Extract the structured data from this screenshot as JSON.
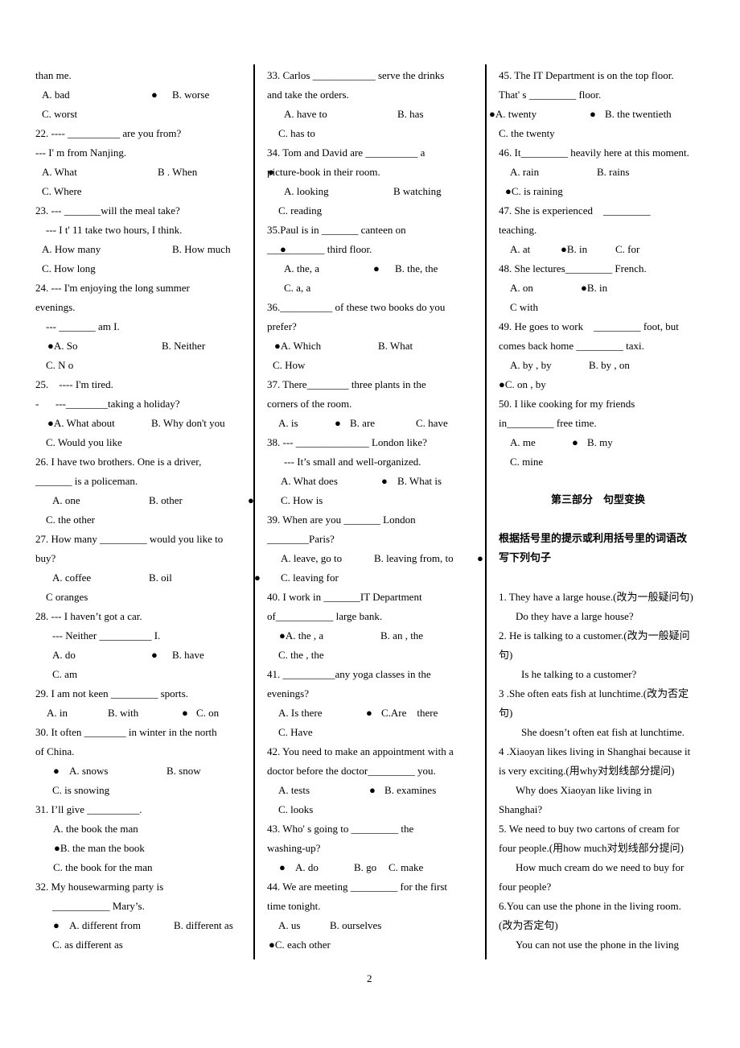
{
  "page_number": "2",
  "columns": {
    "left": [
      [
        "than me."
      ],
      [
        "A. bad",
        "●",
        "B. worse"
      ],
      [
        "C. worst"
      ],
      [
        "22. ---- __________ are you from?"
      ],
      [
        "--- I' m from Nanjing."
      ],
      [
        "A. What",
        "B . When"
      ],
      [
        "C. Where"
      ],
      [
        "23. --- _______will the meal take?"
      ],
      [
        "--- I t' 11 take two hours, I think."
      ],
      [
        "A. How many",
        "B. How much"
      ],
      [
        "C. How long"
      ],
      [
        "24. --- I'm enjoying the long summer"
      ],
      [
        "evenings."
      ],
      [
        "--- _______ am I."
      ],
      [
        "●A. So",
        "B. Neither"
      ],
      [
        "C. N o"
      ],
      [
        "25.    ---- I'm tired."
      ],
      [
        "-",
        "---________taking a holiday?"
      ],
      [
        "●A. What about",
        "B. Why don't you"
      ],
      [
        "C. Would you like"
      ],
      [
        "26. I have two brothers. One is a driver,"
      ],
      [
        "_______ is a policeman."
      ],
      [
        "A. one",
        "B. other",
        "●"
      ],
      [
        "C. the other"
      ],
      [
        "27. How many _________ would you like to"
      ],
      [
        "buy?"
      ],
      [
        "A. coffee",
        "B. oil"
      ],
      [
        "C oranges"
      ],
      [
        "28. --- I haven’t got a car."
      ],
      [
        "--- Neither __________ I."
      ],
      [
        "A. do",
        "●",
        "B. have"
      ],
      [
        "C. am"
      ],
      [
        "29. I am not keen _________ sports."
      ],
      [
        "A. in",
        "B. with",
        "●",
        "C. on"
      ],
      [
        "30. It often ________ in winter in the north"
      ],
      [
        "of China."
      ],
      [
        "●",
        "A. snows",
        "B. snow"
      ],
      [
        "C. is snowing"
      ],
      [
        "31. I’ll give __________."
      ],
      [
        "A. the book the man"
      ],
      [
        "●B. the man the book"
      ],
      [
        "C. the book for the man"
      ],
      [
        "32. My housewarming party is"
      ],
      [
        "___________ Mary’s."
      ],
      [
        "●",
        "A. different from",
        "B. different as"
      ],
      [
        "C. as different as"
      ]
    ],
    "middle": [
      [
        "33. Carlos ____________ serve the drinks"
      ],
      [
        "and take the orders."
      ],
      [
        "A. have to",
        "B. has"
      ],
      [
        "C. has to"
      ],
      [
        "34. Tom and David are __________ a"
      ],
      [
        "picture-book in their room.",
        "●"
      ],
      [
        "A. looking",
        "B watching"
      ],
      [
        "C. reading"
      ],
      [
        "35.Paul is in _______ canteen on"
      ],
      [
        "___________ third floor.",
        "●"
      ],
      [
        "A. the, a",
        "●",
        "B. the, the"
      ],
      [
        "C. a, a"
      ],
      [
        "36.__________ of these two books do you"
      ],
      [
        "prefer?"
      ],
      [
        "●A. Which",
        "B. What"
      ],
      [
        "C. How"
      ],
      [
        "37. There________ three plants in the"
      ],
      [
        "corners of the room."
      ],
      [
        "A. is",
        "●",
        "B. are",
        "C. have"
      ],
      [
        "38. --- ______________ London like?"
      ],
      [
        "--- It’s small and well-organized."
      ],
      [
        "A. What does",
        "●",
        "B. What is"
      ],
      [
        "C. How is"
      ],
      [
        "39. When are you _______ London"
      ],
      [
        "________Paris?"
      ],
      [
        "A. leave, go to",
        "B. leaving from, to",
        "●"
      ],
      [
        "●",
        "C. leaving for"
      ],
      [
        "40. I work in _______IT Department"
      ],
      [
        "of___________ large bank."
      ],
      [
        "●A. the , a",
        "B. an , the"
      ],
      [
        "C. the , the"
      ],
      [
        "41. __________any yoga classes in the"
      ],
      [
        "evenings?"
      ],
      [
        "A. Is there",
        "●",
        "C.Are    there"
      ],
      [
        "C. Have"
      ],
      [
        "42. You need to make an appointment with a"
      ],
      [
        "doctor before the doctor_________ you."
      ],
      [
        "A. tests",
        "●",
        "B. examines"
      ],
      [
        "C. looks"
      ],
      [
        "43. Who' s going to _________ the"
      ],
      [
        "washing-up?"
      ],
      [
        "●",
        "A. do",
        "B. go",
        "C. make"
      ],
      [
        "44. We are meeting _________ for the first"
      ],
      [
        "time tonight."
      ],
      [
        "A. us",
        "B. ourselves"
      ],
      [
        "●C. each other"
      ]
    ],
    "right": [
      [
        "45. The IT Department is on the top floor."
      ],
      [
        "That' s _________ floor."
      ],
      [
        "●A. twenty",
        "●",
        "B. the twentieth"
      ],
      [
        "C. the twenty"
      ],
      [
        "46. It_________ heavily here at this moment."
      ],
      [
        "A. rain",
        "B. rains"
      ],
      [
        "●C. is raining"
      ],
      [
        "47. She is experienced    _________"
      ],
      [
        "teaching."
      ],
      [
        "A. at",
        "●B. in",
        "C. for"
      ],
      [
        "48. She lectures_________ French."
      ],
      [
        "A. on",
        "●B. in"
      ],
      [
        "C with"
      ],
      [
        "49. He goes to work    _________ foot, but"
      ],
      [
        "comes back home _________ taxi."
      ],
      [
        "A. by , by",
        "B. by , on"
      ],
      [
        "●C. on , by"
      ],
      [
        "50. I like cooking for my friends"
      ],
      [
        "in_________ free time."
      ],
      [
        "A. me",
        "●",
        "B. my"
      ],
      [
        "C. mine"
      ],
      [],
      [
        "第三部分　句型变换"
      ],
      [],
      [
        "根据括号里的提示或利用括号里的词语改"
      ],
      [
        "写下列句子"
      ],
      [],
      [
        "1. They have a large house.(改为一般疑问句)"
      ],
      [
        "Do they have a large house?"
      ],
      [
        "2. He is talking to a customer.(改为一般疑问"
      ],
      [
        "句)"
      ],
      [
        "Is he talking to a customer?"
      ],
      [
        "3 .She often eats fish at lunchtime.(改为否定"
      ],
      [
        "句)"
      ],
      [
        "She doesn’t often eat fish at lunchtime."
      ],
      [
        "4 .Xiaoyan likes living in Shanghai because it"
      ],
      [
        "is very exciting.(用why对划线部分提问)"
      ],
      [
        "Why does Xiaoyan like living in"
      ],
      [
        "Shanghai?"
      ],
      [
        "5. We need to buy two cartons of cream for"
      ],
      [
        "four people.(用how much对划线部分提问)"
      ],
      [
        "How much cream do we need to buy for"
      ],
      [
        "four people?"
      ],
      [
        "6.You can use the phone in the living room."
      ],
      [
        "(改为否定句)"
      ],
      [
        "You can not use the phone in the living"
      ]
    ]
  }
}
